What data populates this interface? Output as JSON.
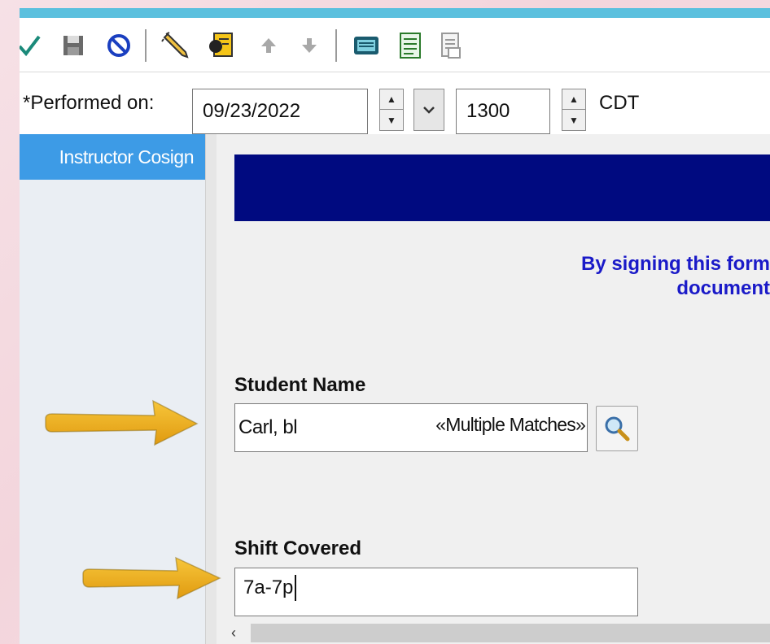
{
  "toolbar": {
    "buttons": [
      {
        "name": "sign-check-icon",
        "color": "#1a8a7a"
      },
      {
        "name": "save-icon",
        "color": "#555555"
      },
      {
        "name": "cancel-icon",
        "color": "#1a3fc0"
      },
      {
        "name": "pencil-icon",
        "color": "#333333"
      },
      {
        "name": "form-icon",
        "color": "#d9a400"
      },
      {
        "name": "up-arrow-icon",
        "color": "#a0a0a0"
      },
      {
        "name": "down-arrow-icon",
        "color": "#a0a0a0"
      },
      {
        "name": "calculator-icon",
        "color": "#1a5b6e"
      },
      {
        "name": "checklist-icon",
        "color": "#2a7a2a"
      },
      {
        "name": "document-icon",
        "color": "#999999"
      }
    ]
  },
  "performed": {
    "label": "*Performed on:",
    "date": "09/23/2022",
    "time": "1300",
    "timezone": "CDT"
  },
  "sidebar": {
    "items": [
      {
        "label": "Instructor Cosign",
        "selected": true
      }
    ]
  },
  "form": {
    "sign_text_line1": "By signing this form",
    "sign_text_line2": "document",
    "student_name_label": "Student Name",
    "student_name_value": "Carl, bl",
    "student_name_match": "«Multiple Matches»",
    "shift_label": "Shift Covered",
    "shift_value": "7a-7p"
  },
  "colors": {
    "banner": "#000a80",
    "sidebar_selected": "#3d9be6",
    "annotation_arrow": "#f0b41c",
    "sign_text": "#1a1ac8"
  }
}
